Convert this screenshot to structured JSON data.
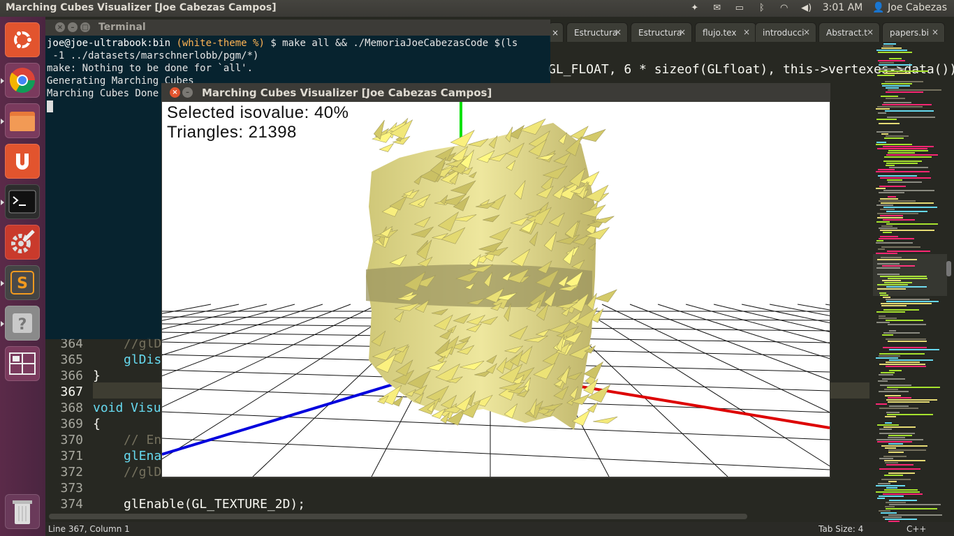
{
  "panel": {
    "app_title": "Marching Cubes Visualizer [Joe Cabezas Campos]",
    "time": "3:01 AM",
    "user": "Joe Cabezas"
  },
  "tabs": [
    {
      "label": "Estructura"
    },
    {
      "label": "Estructura"
    },
    {
      "label": "flujo.tex"
    },
    {
      "label": "introducci"
    },
    {
      "label": "Abstract.t"
    },
    {
      "label": "papers.bi"
    }
  ],
  "editor": {
    "hidden_line_top": "GL_FLOAT, 6 * sizeof(GLfloat), this->vertexes->data());",
    "lines": [
      {
        "num": "364",
        "text": "//glD"
      },
      {
        "num": "365",
        "text": "glDis"
      },
      {
        "num": "366",
        "text": "}"
      },
      {
        "num": "367",
        "text": ""
      },
      {
        "num": "368",
        "text": "void Visu"
      },
      {
        "num": "369",
        "text": "{"
      },
      {
        "num": "370",
        "text": "// En"
      },
      {
        "num": "371",
        "text": "glEna"
      },
      {
        "num": "372",
        "text": "//glD"
      },
      {
        "num": "373",
        "text": ""
      },
      {
        "num": "374",
        "text": "glEnable(GL_TEXTURE_2D);"
      }
    ],
    "status_position": "Line 367, Column 1",
    "tab_size": "Tab Size: 4",
    "syntax": "C++"
  },
  "terminal": {
    "title": "Terminal",
    "prompt_user": "joe@joe-ultrabook",
    "prompt_dir": ":bin",
    "prompt_branch": "(white-theme %)",
    "command": " $ make all && ./MemoriaJoeCabezasCode $(ls",
    "command_cont": " -1 ../datasets/marschnerlobb/pgm/*)",
    "output": [
      "make: Nothing to be done for `all'.",
      "Generating Marching Cubes",
      "Marching Cubes Done"
    ]
  },
  "visualizer": {
    "title": "Marching Cubes Visualizer [Joe Cabezas Campos]",
    "isovalue_label": "Selected  isovalue:  40%",
    "triangles_label": "Triangles:  21398"
  },
  "colors": {
    "launcher": "#5b2a49",
    "terminal_bg": "#002232",
    "surface": "#e6df8c",
    "axis_x": "#dd0000",
    "axis_y": "#00dd00",
    "axis_z": "#0000dd"
  }
}
